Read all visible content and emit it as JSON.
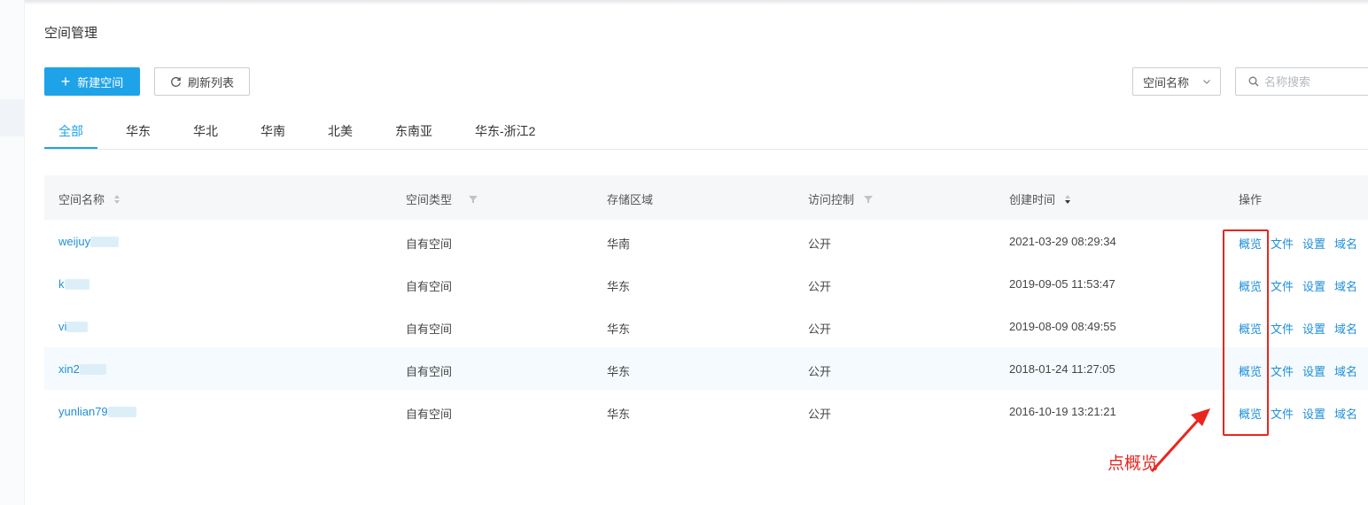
{
  "page_title": "空间管理",
  "toolbar": {
    "new_button": "新建空间",
    "refresh_button": "刷新列表",
    "search_field_select": "空间名称",
    "search_placeholder": "名称搜索"
  },
  "tabs": [
    "全部",
    "华东",
    "华北",
    "华南",
    "北美",
    "东南亚",
    "华东-浙江2"
  ],
  "active_tab": "全部",
  "table": {
    "headers": {
      "name": "空间名称",
      "type": "空间类型",
      "region": "存储区域",
      "access": "访问控制",
      "created": "创建时间",
      "ops": "操作"
    },
    "rows": [
      {
        "name": "weijuy",
        "type": "自有空间",
        "region": "华南",
        "access": "公开",
        "created": "2021-03-29 08:29:34"
      },
      {
        "name": "k",
        "type": "自有空间",
        "region": "华东",
        "access": "公开",
        "created": "2019-09-05 11:53:47"
      },
      {
        "name": "vi",
        "type": "自有空间",
        "region": "华东",
        "access": "公开",
        "created": "2019-08-09 08:49:55"
      },
      {
        "name": "xin2",
        "type": "自有空间",
        "region": "华东",
        "access": "公开",
        "created": "2018-01-24 11:27:05"
      },
      {
        "name": "yunlian79",
        "type": "自有空间",
        "region": "华东",
        "access": "公开",
        "created": "2016-10-19 13:21:21"
      }
    ],
    "actions": {
      "overview": "概览",
      "files": "文件",
      "settings": "设置",
      "domain": "域名"
    }
  },
  "annotation": {
    "text": "点概览",
    "color": "#e8261f"
  },
  "colors": {
    "accent": "#1fa3e8",
    "link": "#1f8fd8",
    "highlight_row": "#f4fafd"
  }
}
